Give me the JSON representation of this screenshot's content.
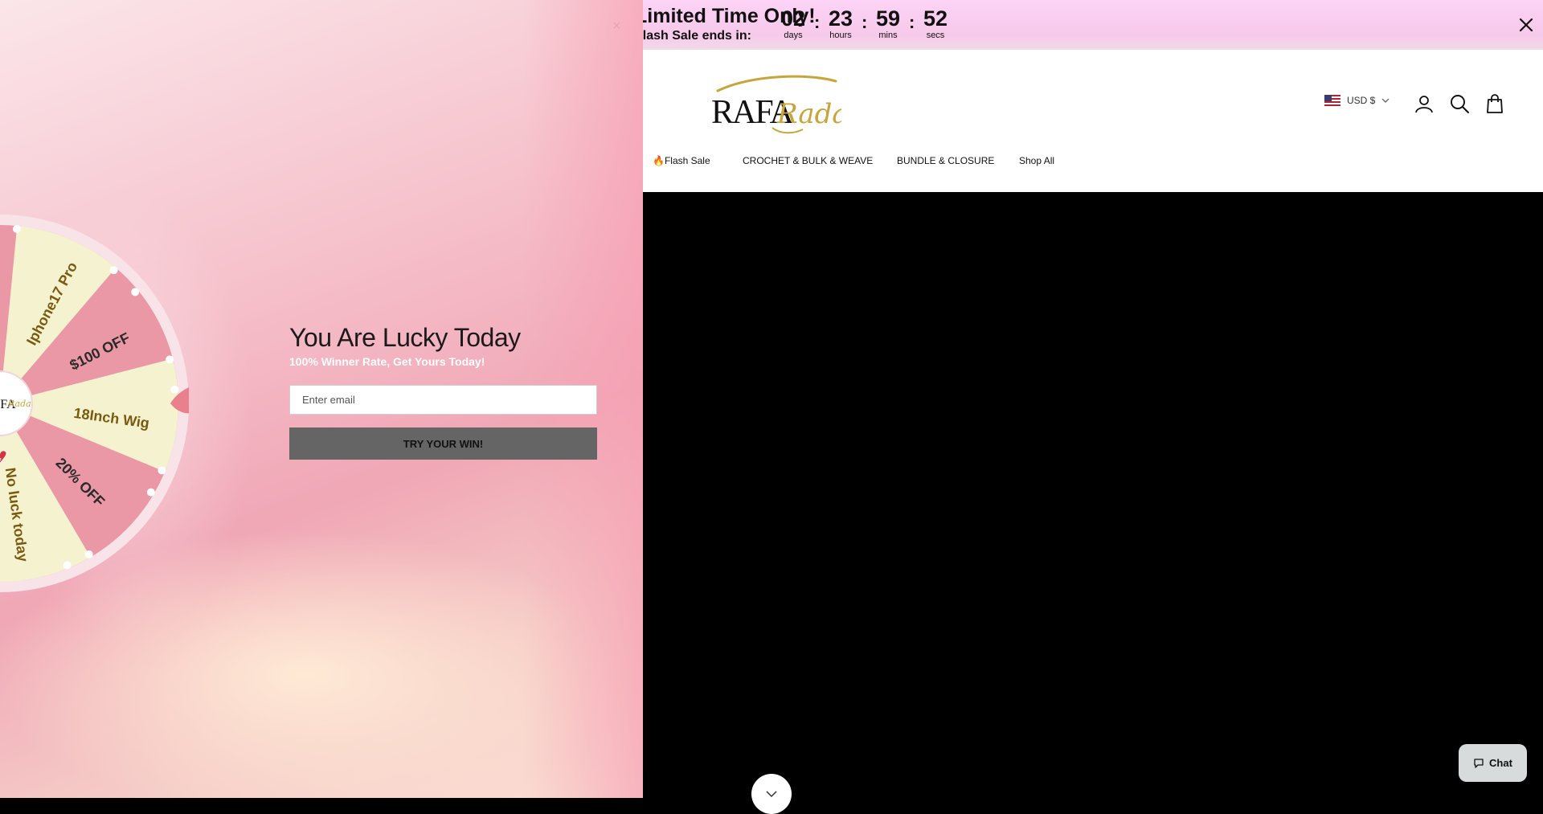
{
  "announcement": {
    "headline": "Limited Time Only!",
    "subline": "Flash Sale ends in:",
    "countdown": [
      {
        "value": "02",
        "label": "days"
      },
      {
        "value": "23",
        "label": "hours"
      },
      {
        "value": "59",
        "label": "mins"
      },
      {
        "value": "52",
        "label": "secs"
      }
    ],
    "separator": ":",
    "close_icon": "close-icon"
  },
  "header": {
    "logo": {
      "main": "RAFA",
      "script": "Rada"
    },
    "currency": "USD $",
    "icons": [
      "account-icon",
      "search-icon",
      "cart-icon"
    ]
  },
  "nav": {
    "flash_sale": "🔥Flash Sale",
    "items": [
      "CROCHET & BULK & WEAVE",
      "BUNDLE & CLOSURE",
      "Shop All"
    ]
  },
  "chat": {
    "label": "Chat"
  },
  "popup": {
    "close": "×",
    "title": "You Are Lucky Today",
    "subtitle": "100% Winner Rate, Get Yours Today!",
    "email_placeholder": "Enter email",
    "button": "TRY YOUR WIN!",
    "wheel": {
      "segments": [
        {
          "label": "Iphone17 Pro",
          "color": "#f5f2cf"
        },
        {
          "label": "$100 OFF",
          "color": "#ea97a6"
        },
        {
          "label": "18Inch Wig",
          "color": "#f5f2cf"
        },
        {
          "label": "20% OFF",
          "color": "#ea97a6"
        },
        {
          "label": "No luck today",
          "color": "#f5f2cf"
        }
      ],
      "no_luck_icon": "broken-heart-icon",
      "center_logo": {
        "main": "RAFA",
        "script": "Rada"
      }
    },
    "colors": {
      "button": "#656565",
      "pointer": "#e9808b",
      "wheel_rim": "#f8e4e8"
    }
  }
}
